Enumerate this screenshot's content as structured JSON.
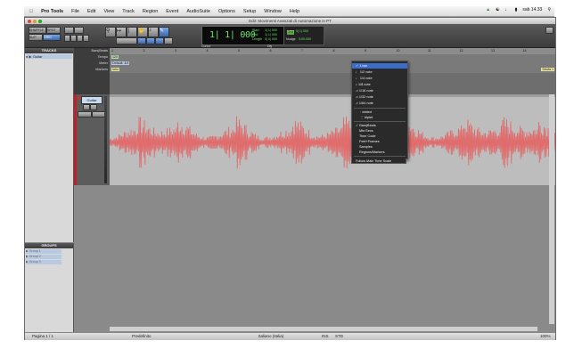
{
  "menubar": {
    "apple": "",
    "app": "Pro Tools",
    "items": [
      "File",
      "Edit",
      "View",
      "Track",
      "Region",
      "Event",
      "AudioSuite",
      "Options",
      "Setup",
      "Window",
      "Help"
    ],
    "clock": "sab 14.33"
  },
  "window": {
    "title": "Edit: Movimenti Avanzati di Automazione in PT"
  },
  "toolbar": {
    "mode_shuffle": "SHUFFLE",
    "mode_spot": "SPOT",
    "mode_slip": "SLIP",
    "mode_grid": "GRID",
    "counter_main": "1| 1| 000",
    "start_label": "Start",
    "end_label": "End",
    "length_label": "Length",
    "start_value": "1| 1| 000",
    "end_value": "1| 1| 000",
    "length_value": "0| 0| 000",
    "cursor_label": "Cursor",
    "grid_label": "Grid",
    "grid_value": "0| 1| 000",
    "nudge_label": "Nudge",
    "nudge_value": "0:00.000",
    "dly_label": "Dly"
  },
  "dropdown": {
    "items": [
      "Bars|Beats",
      "Min:Secs",
      "Time Code",
      "Feet+Frames",
      "Samples",
      "Regions/Markers"
    ],
    "notes": [
      "1/2 note",
      "1/4 note",
      "1/8 note",
      "1/16 note",
      "1/32 note",
      "1/64 note"
    ],
    "bar": "1 bar",
    "dotted": "dotted",
    "triplet": "triplet",
    "follow": "Follow Main Time Scale"
  },
  "tracks_panel": {
    "title": "TRACKS",
    "track": "Guitar"
  },
  "groups_panel": {
    "title": "GROUPS",
    "items": [
      "Group 1",
      "Group 2",
      "Group 3"
    ]
  },
  "rulers": {
    "rows": [
      "Bars|Beats",
      "Tempo",
      "Meter",
      "Markers",
      ""
    ],
    "tempo": "120",
    "meter": "Default: 4/4",
    "marker": "Intro",
    "marker_right": "Strofa 1"
  },
  "edit": {
    "track_name": "Guitar",
    "bar_numbers": [
      "1",
      "2",
      "3",
      "4",
      "5",
      "6",
      "7",
      "8",
      "9",
      "10",
      "11",
      "12",
      "13",
      "14"
    ]
  },
  "status": {
    "page": "Pagina 1 / 1",
    "style": "Predefinito",
    "language": "Italiano (Italia)",
    "keyb": "INS",
    "std": "STD",
    "zoom": "100%"
  }
}
